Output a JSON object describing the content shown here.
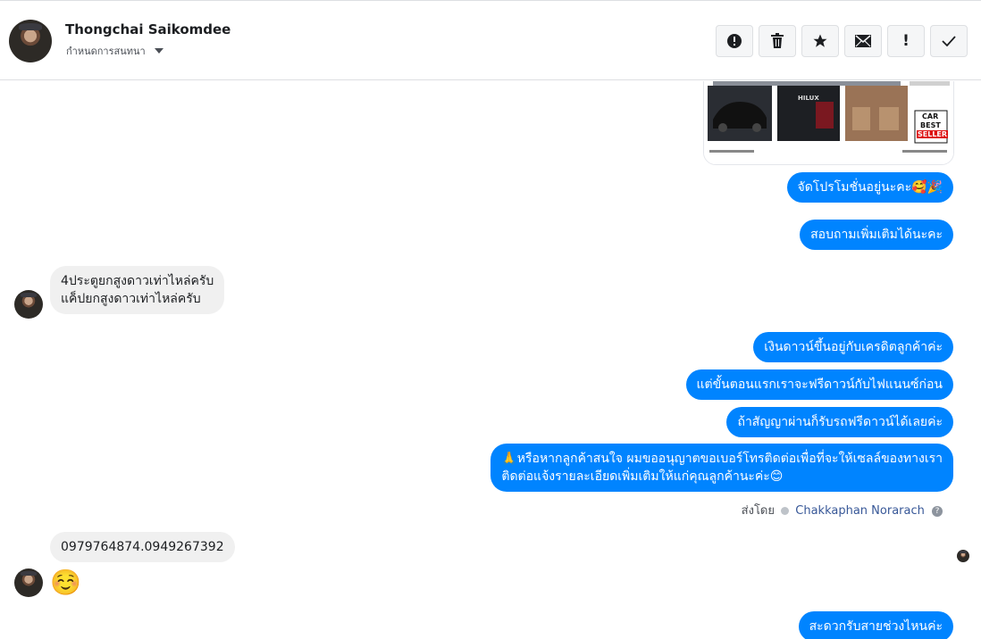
{
  "header": {
    "name": "Thongchai Saikomdee",
    "subtitle": "กำหนดการสนทนา",
    "buttons": [
      {
        "name": "report-icon",
        "glyph": "!"
      },
      {
        "name": "trash-icon",
        "glyph": "🗑"
      },
      {
        "name": "star-icon",
        "glyph": "★"
      },
      {
        "name": "mail-icon",
        "glyph": "✉"
      },
      {
        "name": "important-icon",
        "glyph": "!"
      },
      {
        "name": "check-icon",
        "glyph": "✓"
      }
    ]
  },
  "image_card": {
    "brand": "HILUX",
    "logo": [
      "CAR",
      "BEST",
      "SELLER"
    ]
  },
  "messages": {
    "out1": "จัดโปรโมชั่นอยู่นะคะ🥰🎉",
    "out2": "สอบถามเพิ่มเติมได้นะคะ",
    "in1_line1": "4ประตูยกสูงดาวเท่าไหล่ครับ",
    "in1_line2": "แค็ปยกสูงดาวเท่าไหล่ครับ",
    "out3": "เงินดาวน์ขึ้นอยู่กับเครดิตลูกค้าค่ะ",
    "out4": "แต่ขั้นตอนแรกเราจะฟรีดาวน์กับไฟแนนซ์ก่อน",
    "out5": "ถ้าสัญญาผ่านก็รับรถฟรีดาวน์ได้เลยค่ะ",
    "out6_line1": "🙏หรือหากลูกค้าสนใจ ผมขออนุญาตขอเบอร์โทรติดต่อเพื่อที่จะให้เซลล์ของทางเรา",
    "out6_line2": "ติดต่อแจ้งรายละเอียดเพิ่มเติมให้แก่คุณลูกค้านะค่ะ😊",
    "sent_by_label": "ส่งโดย",
    "sent_by_name": "Chakkaphan Norarach",
    "in2": "0979764874.0949267392",
    "in3_emoji": "☺️",
    "out7": "สะดวกรับสายช่วงไหนค่ะ"
  },
  "colors": {
    "outgoing": "#0084ff",
    "incoming": "#f0f0f0"
  }
}
